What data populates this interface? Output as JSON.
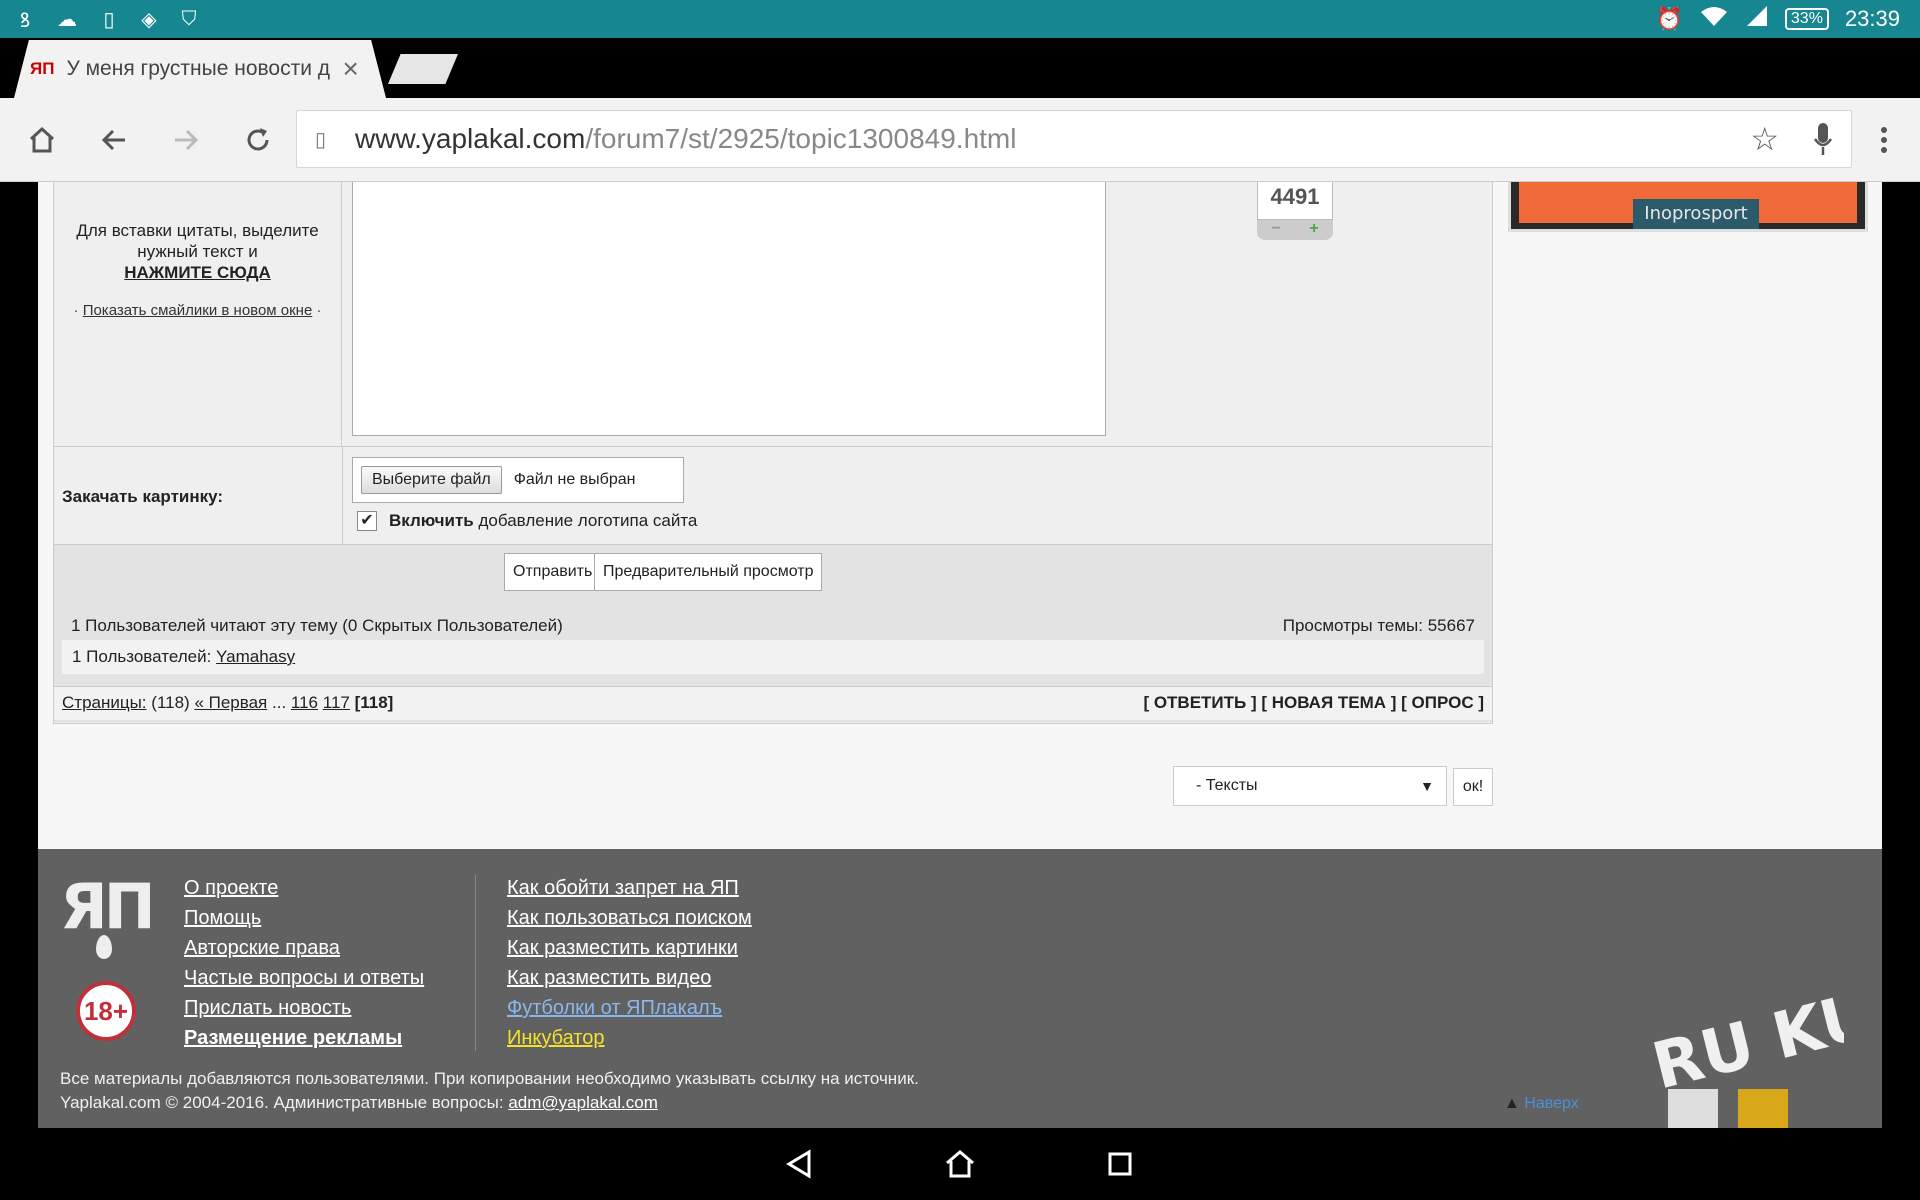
{
  "status_bar": {
    "time": "23:39",
    "battery": "33%",
    "icons": [
      "wireless-charging-icon",
      "cloud-icon",
      "sim-card-icon",
      "vpn-icon",
      "shield-icon",
      "alarm-icon",
      "wifi-icon",
      "signal-icon"
    ]
  },
  "browser": {
    "tab_title": "У меня грустные новости д",
    "tab_favicon": "ЯП",
    "url_host": "www.yaplakal.com",
    "url_path": "/forum7/st/2925/topic1300849.html"
  },
  "reply_form": {
    "quote_hint": "Для вставки цитаты, выделите нужный текст и",
    "click_here": "НАЖМИТЕ СЮДА",
    "smiles_link": "Показать смайлики в новом окне",
    "counter": "4491",
    "upload_label": "Закачать картинку:",
    "choose_file": "Выберите файл",
    "no_file": "Файл не выбран",
    "logo_bold": "Включить",
    "logo_rest": "добавление логотипа сайта",
    "submit": "Отправить",
    "preview": "Предварительный просмотр"
  },
  "stats": {
    "readers": "1 Пользователей читают эту тему (0 Скрытых Пользователей)",
    "views": "Просмотры темы: 55667",
    "users_prefix": "1 Пользователей:",
    "user_name": "Yamahasy"
  },
  "pager": {
    "label": "Страницы:",
    "count": "(118)",
    "first": "« Первая",
    "dots": "...",
    "p1": "116",
    "p2": "117",
    "current": "[118]",
    "actions": "[ ОТВЕТИТЬ ] [ НОВАЯ ТЕМА ] [ ОПРОС ]"
  },
  "jump": {
    "selected": "- Тексты",
    "ok": "ок!"
  },
  "ad": {
    "label": "Inoprosport"
  },
  "footer": {
    "logo": "ЯП",
    "age": "18+",
    "links_left": [
      "О проекте",
      "Помощь",
      "Авторские права",
      "Частые вопросы и ответы",
      "Прислать новость",
      "Размещение рекламы"
    ],
    "links_right": [
      "Как обойти запрет на ЯП",
      "Как пользоваться поиском",
      "Как разместить картинки",
      "Как разместить видео",
      "Футболки от ЯПлакалъ",
      "Инкубатор"
    ],
    "copy1": "Все материалы добавляются пользователями. При копировании необходимо указывать ссылку на источник.",
    "copy2": "Yaplakal.com © 2004-2016. Административные вопросы:",
    "email_user": "adm",
    "email_domain": "@yaplakal.com",
    "up": "Наверх",
    "ruku": "RU KU"
  },
  "colors": {
    "status": "#168690",
    "footer": "#616161",
    "ad": "#f06a3a"
  }
}
